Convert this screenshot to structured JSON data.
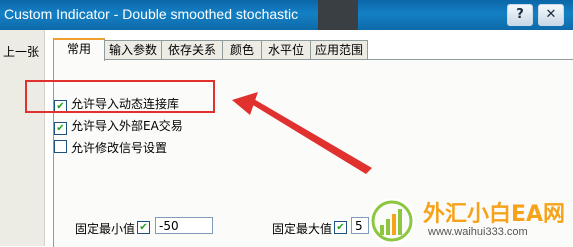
{
  "window": {
    "title": "Custom Indicator - Double smoothed stochastic",
    "help_button": "?",
    "close_button": "✕"
  },
  "nav": {
    "prev_label": "上一张"
  },
  "tabs": [
    {
      "label": "常用",
      "active": true
    },
    {
      "label": "输入参数",
      "active": false
    },
    {
      "label": "依存关系",
      "active": false
    },
    {
      "label": "颜色",
      "active": false
    },
    {
      "label": "水平位",
      "active": false
    },
    {
      "label": "应用范围",
      "active": false
    }
  ],
  "options": [
    {
      "label": "允许导入动态连接库",
      "checked": true
    },
    {
      "label": "允许导入外部EA交易",
      "checked": true
    },
    {
      "label": "允许修改信号设置",
      "checked": false
    }
  ],
  "fixed_min": {
    "label": "固定最小值",
    "checked": true,
    "value": "-50"
  },
  "fixed_max": {
    "label": "固定最大值",
    "checked": true,
    "value": "5"
  },
  "watermark": {
    "brand": "外汇小白EA网",
    "url": "www.waihui333.com"
  },
  "colors": {
    "title_bar": "#1478c0",
    "highlight": "#e0312f",
    "active_tab_accent": "#f0a030",
    "check": "#21a121"
  }
}
